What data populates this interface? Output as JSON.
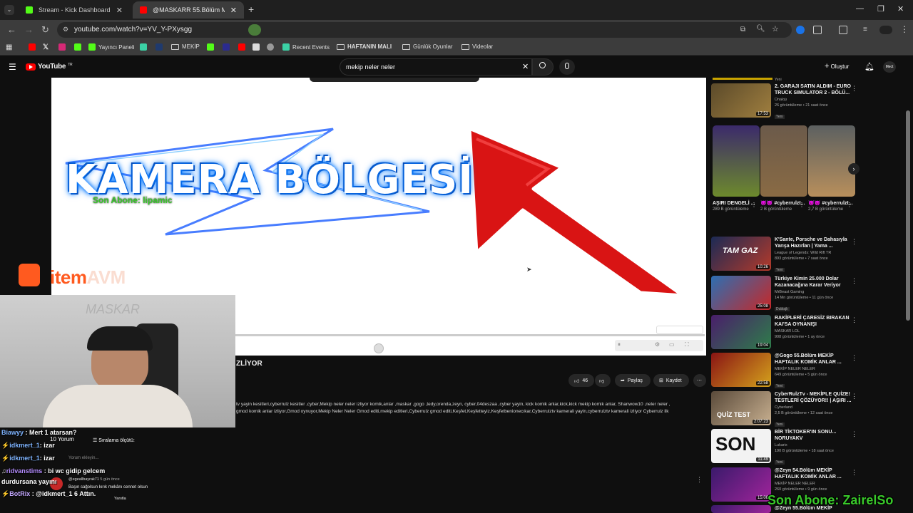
{
  "tabs": [
    {
      "label": "Stream - Kick Dashboard",
      "active": false
    },
    {
      "label": "@MASKARR 55.Bölüm MEKİP H",
      "active": true
    }
  ],
  "url": "youtube.com/watch?v=YV_Y-PXysgg",
  "bookmarks": [
    {
      "label": ""
    },
    {
      "label": ""
    },
    {
      "label": ""
    },
    {
      "label": ""
    },
    {
      "label": "Yayıncı Paneli"
    },
    {
      "label": ""
    },
    {
      "label": ""
    },
    {
      "label": "MEKİP"
    },
    {
      "label": ""
    },
    {
      "label": ""
    },
    {
      "label": ""
    },
    {
      "label": ""
    },
    {
      "label": ""
    },
    {
      "label": "Recent Events"
    },
    {
      "label": "HAFTANIN MALI"
    },
    {
      "label": "Günlük Oyunlar"
    },
    {
      "label": "Videolar"
    }
  ],
  "youtube": {
    "logo": "YouTube",
    "country": "TR",
    "search_query": "mekip neler neler",
    "create_label": "Oluştur",
    "avatar_text": "Mect"
  },
  "video": {
    "overlay_title": "KAMERA BÖLGESİ",
    "son_abone": "Son Abone: lipamic",
    "sponsor_main": "item",
    "sponsor_tail": "AVM",
    "title_fragment": "ZLİYOR",
    "likes": "46",
    "share_label": "Paylaş",
    "save_label": "Kaydet",
    "description_line1": "tv yayin kesitleri,cyberrulz kesitler ,cyber,Mekip neler neler izliyor komik,anlar ,maskar ,gogo ,tedy,orenda,zeyn, cyber,04deszaa ,cyber yayin, kick komik anlar,kick,kick mekip komik anlar, Shanwow10 ,neler neler ,",
    "description_line2": "gmod komik anlar izliyor,Gmod oynuyor,Mekip Neler Neler Gmod editi,mekip editleri,Cyberrulz gmod editi,Keşfet,Keşfetteyiz,Keşfetbenionecıkar,Cyberrulztv kamerali yayin,cyberrulztv kamerali izliyor Cyberrulz ilk"
  },
  "comments": {
    "count_label": "10 Yorum",
    "sort_label": "Sıralama ölçütü:",
    "add_placeholder": "Yorum ekleyin...",
    "first_comment_author": "@egeallbayrak71",
    "first_comment_time": "5 gün önce",
    "first_comment_text": "Başın sağolsun kırık mekânı cennet olsun",
    "reply_label": "Yanıtla"
  },
  "chat": [
    {
      "user": "Biawyy",
      "msg": "Mert 1 atarsan?"
    },
    {
      "user": "idkmert_1",
      "msg": ": izar"
    },
    {
      "user": "idkmert_1",
      "msg": ": izar"
    },
    {
      "user": "ridvanstims",
      "msg": ": bi wc gidip gelcem"
    },
    {
      "user": "",
      "msg": "durdursana yayını"
    },
    {
      "user": "BotRix",
      "msg": ": @idkmert_1 6 Attın."
    }
  ],
  "sidebar": {
    "top_video": {
      "title": "2. GARAJI SATIN ALDIM - EURO TRUCK SIMULATOR 2 - BÖLÜ...",
      "channel": "Ünalojı",
      "meta": "26 görüntüleme • 21 saat önce",
      "badge": "Yeni",
      "duration": "17:53"
    },
    "shorts": [
      {
        "title": "AŞIRI DENGELİ ...",
        "views": "289 B görüntüleme"
      },
      {
        "title": "😈😈 #cyberrulzt...",
        "views": "2 B görüntüleme"
      },
      {
        "title": "😈😈 #cyberrulzt...",
        "views": "2,7 B görüntüleme"
      }
    ],
    "videos": [
      {
        "title": "K'Sante, Porsche ve Dahasıyla Yarışa Hazırlan | Yama ...",
        "channel": "League of Legends: Wild Rift TR",
        "meta": "893 görüntüleme • 7 saat önce",
        "badge": "Yeni",
        "duration": "10:26",
        "thumb_text": "TAM GAZ"
      },
      {
        "title": "Türkiye Kimin 25.000 Dolar Kazanacağına Karar Veriyor",
        "channel": "MrBeast Gaming",
        "meta": "14 Mn görüntüleme • 11 gün önce",
        "badge": "Dublajlı",
        "duration": "25:08",
        "thumb_text": ""
      },
      {
        "title": "RAKİPLERİ ÇARESİZ BIRAKAN KAI'SA OYNANIŞI",
        "channel": "MASKAR LOL",
        "meta": "908 görüntüleme • 1 ay önce",
        "badge": "",
        "duration": "19:04",
        "thumb_text": ""
      },
      {
        "title": "@Gogo 55.Bölüm MEKİP HAFTALIK KOMİK ANLAR ...",
        "channel": "MEKİP NELER NELER",
        "meta": "649 görüntüleme • 5 gün önce",
        "badge": "Yeni",
        "duration": "22:58",
        "thumb_text": ""
      },
      {
        "title": "CyberRulzTv - MEKİPLE QUİZE! TESTLERİ ÇÖZÜYOR!! | AŞIRI ...",
        "channel": "Cyberland",
        "meta": "2,5 B görüntüleme • 12 saat önce",
        "badge": "Yeni",
        "duration": "2:07:23",
        "thumb_text": "QUİZ TEST"
      },
      {
        "title": "BİR TİKTOKER'IN SONU... NORUYAKV",
        "channel": "Lukarix",
        "meta": "190 B görüntüleme • 18 saat önce",
        "badge": "Yeni",
        "duration": "11:49",
        "thumb_text": "SON"
      },
      {
        "title": "@Zeyn 54.Bölüm MEKİP HAFTALIK KOMİK ANLAR ...",
        "channel": "MEKİP NELER NELER",
        "meta": "260 görüntüleme • 9 gün önce",
        "badge": "",
        "duration": "15:06",
        "thumb_text": ""
      },
      {
        "title": "@Zeyn 55.Bölüm MEKİP",
        "channel": "",
        "meta": "",
        "badge": "",
        "duration": "",
        "thumb_text": ""
      }
    ]
  },
  "overlay_right": "Son Abone: ZairelSo",
  "colors": {
    "kick_green": "#53fc18",
    "youtube_red": "#ff0000",
    "overlay_green": "#39c82a"
  }
}
